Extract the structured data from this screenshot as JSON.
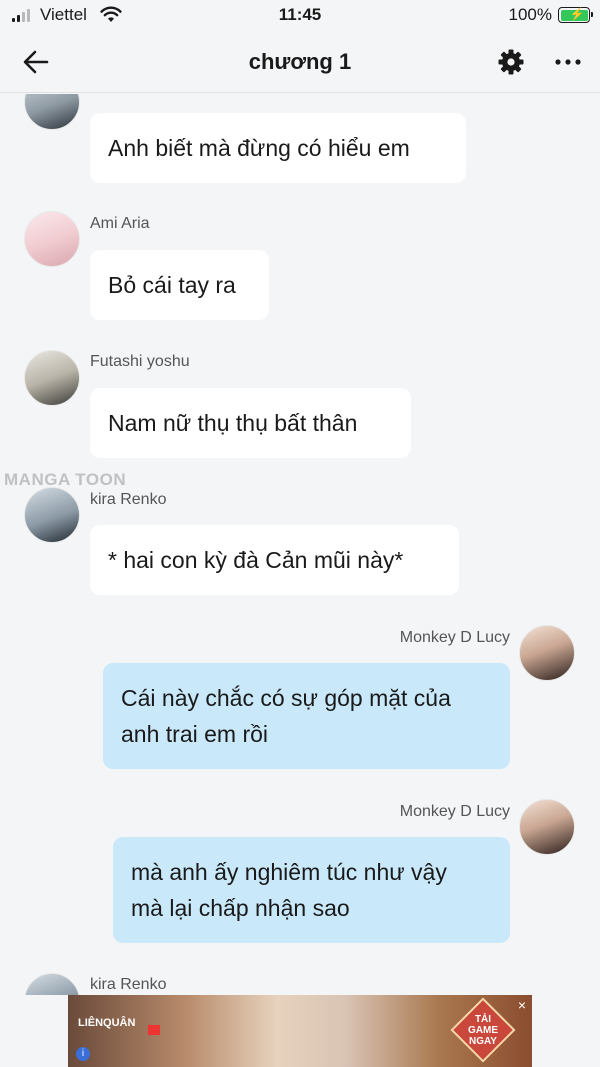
{
  "status_bar": {
    "carrier": "Viettel",
    "time": "11:45",
    "battery_percent": "100%"
  },
  "nav": {
    "title": "chương 1",
    "icons": [
      "back-arrow-icon",
      "gear-icon",
      "more-icon"
    ]
  },
  "watermark": "MANGA TOON",
  "messages": [
    {
      "sender": "",
      "text": "Anh biết mà đừng có hiểu em",
      "side": "left"
    },
    {
      "sender": "Ami Aria",
      "text": "Bỏ cái tay ra",
      "side": "left"
    },
    {
      "sender": "Futashi yoshu",
      "text": "Nam nữ thụ thụ bất thân",
      "side": "left"
    },
    {
      "sender": "kira Renko",
      "text": "* hai con kỳ đà Cản mũi này*",
      "side": "left"
    },
    {
      "sender": "Monkey D Lucy",
      "lines": [
        "Cái này chắc có sự góp mặt của",
        "anh trai em rồi"
      ],
      "side": "right"
    },
    {
      "sender": "Monkey D Lucy",
      "lines": [
        "mà anh ấy nghiêm túc như vậy",
        "mà lại chấp nhận sao"
      ],
      "side": "right"
    },
    {
      "sender": "kira Renko",
      "text": "",
      "side": "left"
    }
  ],
  "ad": {
    "brand": "LIÊNQUÂN",
    "cta_lines": [
      "TẢI",
      "GAME",
      "NGAY"
    ],
    "close": "×",
    "info": "i"
  },
  "colors": {
    "background": "#f4f5f7",
    "bubble_other": "#ffffff",
    "bubble_me": "#c9e8fa",
    "battery": "#34c759"
  }
}
